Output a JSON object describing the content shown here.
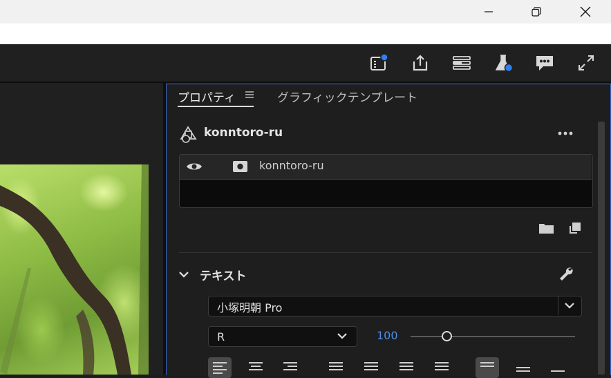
{
  "panel": {
    "tabs": [
      {
        "label": "プロパティ"
      },
      {
        "label": "グラフィックテンプレート"
      }
    ],
    "layer_title": "konntoro-ru",
    "layer_row_name": "konntoro-ru",
    "text_section": {
      "title": "テキスト",
      "font_family": "小塚明朝 Pro",
      "font_style": "R",
      "font_size": "100",
      "font_size_slider_fraction": 0.22
    }
  },
  "colors": {
    "accent_blue": "#4b8ee8",
    "panel_border": "#3a66c4",
    "notification_dot": "#2f7ff0"
  },
  "icons": [
    "minimize-icon",
    "restore-icon",
    "close-icon",
    "quick-export-icon",
    "share-icon",
    "panels-icon",
    "labs-icon",
    "comments-icon",
    "fullscreen-icon",
    "graphic-layer-icon",
    "more-icon",
    "eye-icon",
    "rectangle-layer-icon",
    "new-folder-icon",
    "new-item-icon",
    "chevron-down-icon",
    "wrench-icon"
  ]
}
